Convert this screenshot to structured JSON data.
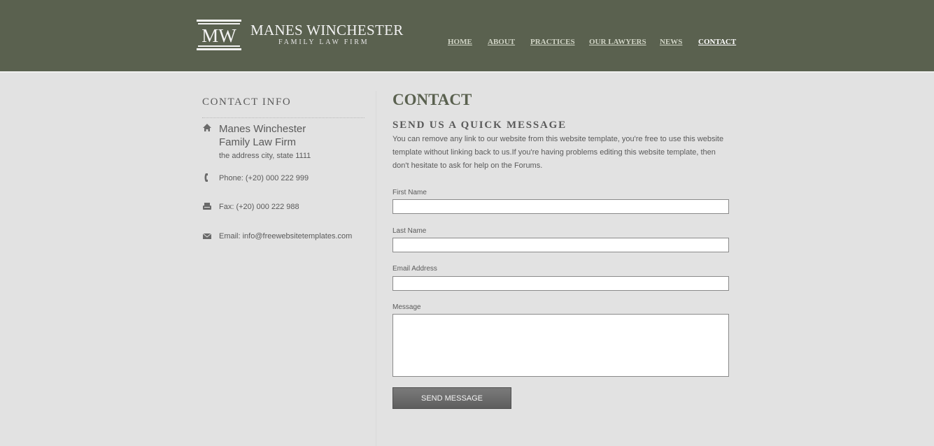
{
  "brand": {
    "name": "MANES WINCHESTER",
    "tagline": "FAMILY LAW FIRM"
  },
  "nav": {
    "items": [
      {
        "label": "HOME"
      },
      {
        "label": "ABOUT"
      },
      {
        "label": "PRACTICES"
      },
      {
        "label": "OUR LAWYERS"
      },
      {
        "label": "NEWS"
      },
      {
        "label": "CONTACT"
      }
    ],
    "active": "CONTACT"
  },
  "sidebar": {
    "title": "CONTACT INFO",
    "firm_line1": "Manes Winchester",
    "firm_line2": "Family Law Firm",
    "address": "the address city, state 1111",
    "phone": "Phone: (+20) 000 222 999",
    "fax": "Fax: (+20) 000 222 988",
    "email": "Email: info@freewebsitetemplates.com"
  },
  "main": {
    "title": "CONTACT",
    "subtitle": "SEND US A QUICK MESSAGE",
    "intro": "You can remove any link to our website from this website template, you're free to use this website template without linking back to us.If you're having problems editing this website template, then don't hesitate to ask for help on the Forums.",
    "form": {
      "first_name_label": "First Name",
      "last_name_label": "Last Name",
      "email_label": "Email Address",
      "message_label": "Message",
      "first_name_value": "",
      "last_name_value": "",
      "email_value": "",
      "message_value": "",
      "submit_label": "SEND MESSAGE"
    }
  },
  "icons": {
    "home": "home-icon",
    "phone": "phone-icon",
    "fax": "fax-icon",
    "email": "envelope-icon"
  },
  "colors": {
    "header_bg": "#5a614f",
    "page_bg": "#e2e2e2",
    "text": "#5a5a5a",
    "button_bg": "#6b6b6b"
  }
}
